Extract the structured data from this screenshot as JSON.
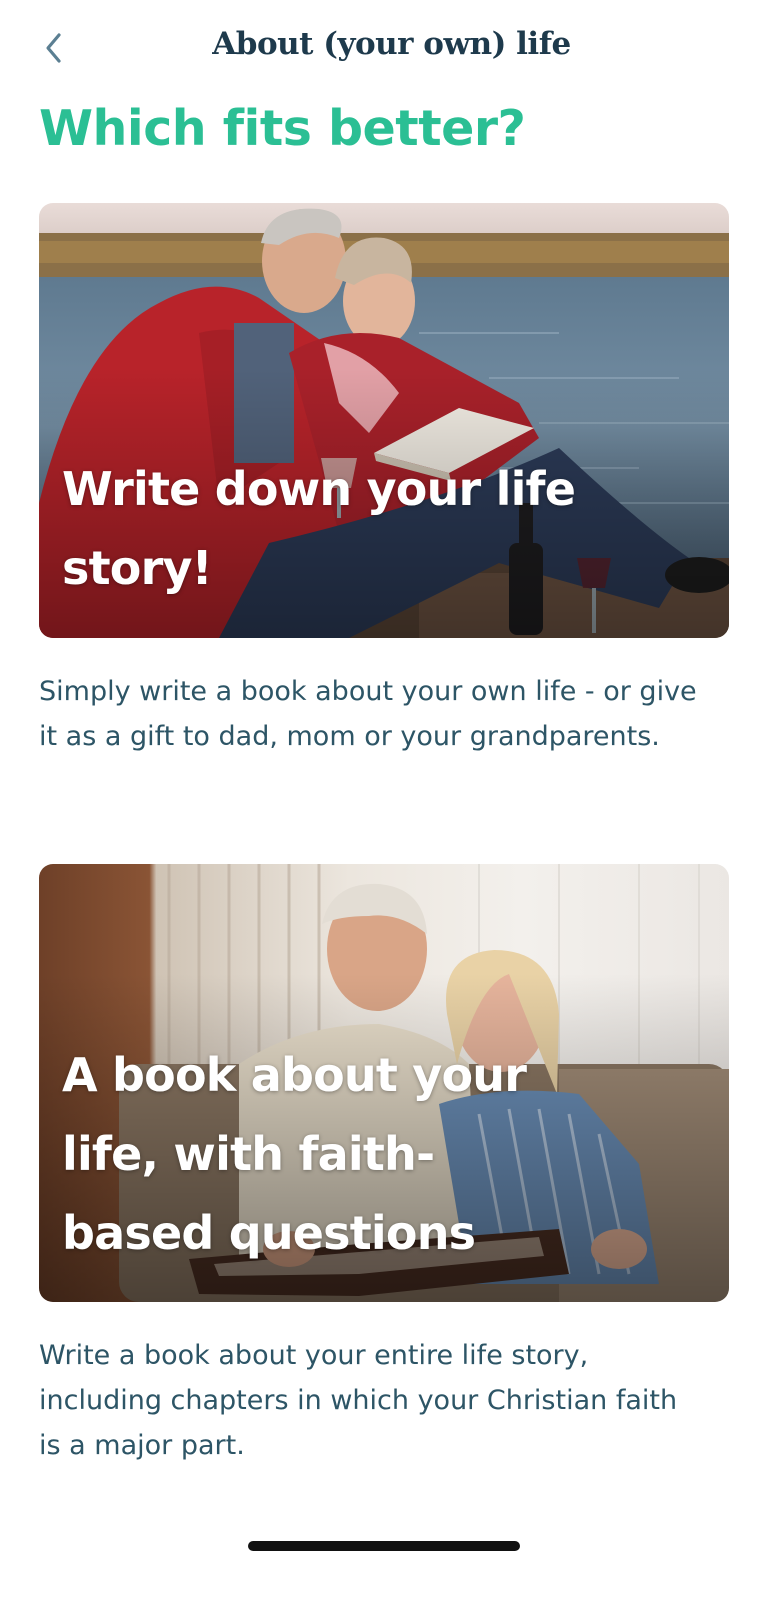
{
  "header": {
    "title": "About (your own) life",
    "back_icon": "chevron-left-icon"
  },
  "page": {
    "heading": "Which fits better?"
  },
  "options": [
    {
      "title": "Write down your life story!",
      "description": "Simply write a book about your own life - or give it as a gift to dad, mom or your grandparents.",
      "image": "photo-elderly-couple-reading-by-lake"
    },
    {
      "title": "A book about your life, with faith-based questions",
      "description": "Write a book about your entire life story, including chapters in which your Christian faith is a major part.",
      "image": "photo-couple-reading-album-on-sofa"
    }
  ],
  "colors": {
    "heading": "#2bbf94",
    "title": "#1e3a4c",
    "description": "#2d5566",
    "back_icon": "#5b7f92"
  }
}
